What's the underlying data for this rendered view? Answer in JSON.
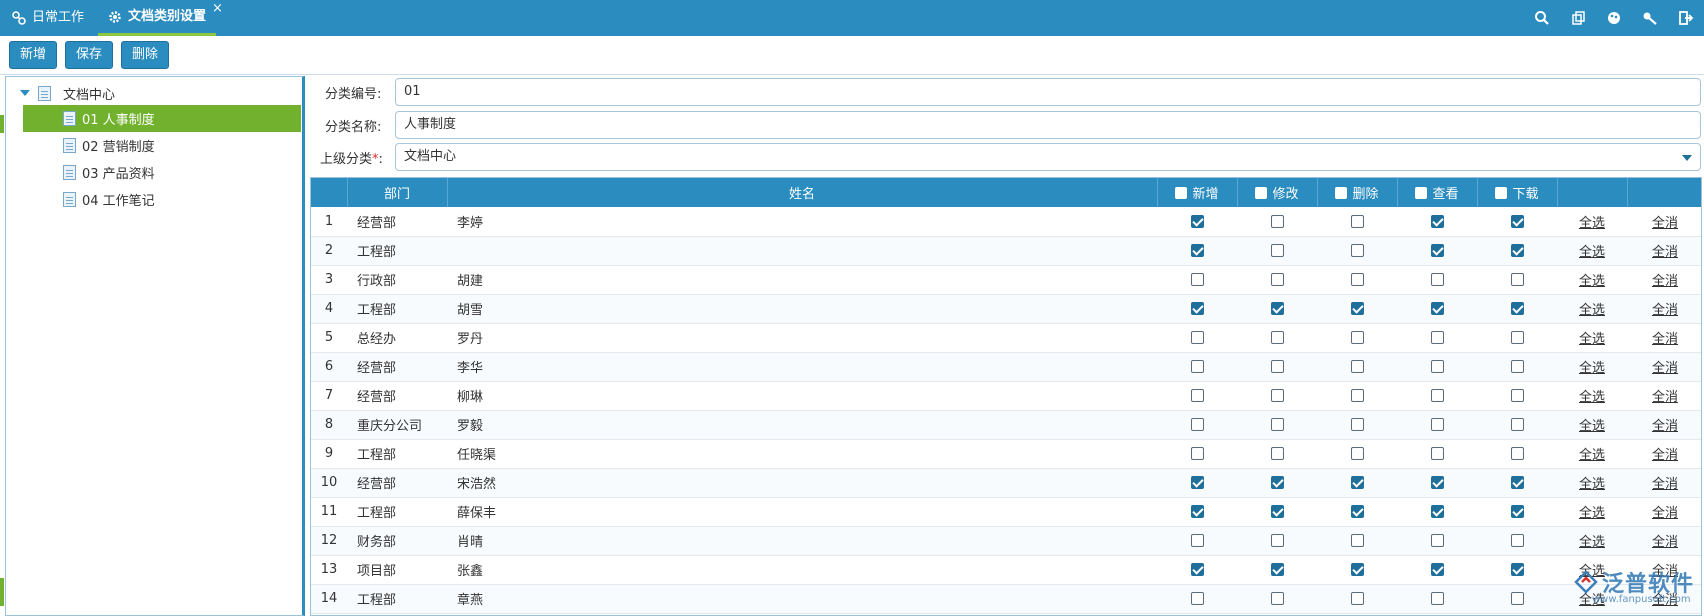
{
  "tabs": [
    {
      "label": "日常工作",
      "icon": "link-icon"
    },
    {
      "label": "文档类别设置",
      "icon": "gear-icon",
      "active": true
    }
  ],
  "tab_close": "×",
  "top_icons": [
    "search-icon",
    "copy-icon",
    "skin-icon",
    "key-icon",
    "logout-icon"
  ],
  "toolbar": {
    "add": "新增",
    "save": "保存",
    "delete": "删除"
  },
  "tree": {
    "root": "文档中心",
    "items": [
      "01 人事制度",
      "02 营销制度",
      "03 产品资料",
      "04 工作笔记"
    ],
    "selected_index": 0
  },
  "form": {
    "code_label": "分类编号:",
    "code_value": "01",
    "name_label": "分类名称:",
    "name_value": "人事制度",
    "parent_label": "上级分类",
    "parent_required": "*",
    "parent_colon": ":",
    "parent_value": "文档中心"
  },
  "grid": {
    "headers": {
      "dept": "部门",
      "name": "姓名",
      "add": "新增",
      "edit": "修改",
      "del": "删除",
      "view": "查看",
      "download": "下载"
    },
    "select_all": "全选",
    "deselect_all": "全消",
    "rows": [
      {
        "no": "1",
        "dept": "经营部",
        "name": "李婷",
        "perms": [
          true,
          false,
          false,
          true,
          true
        ]
      },
      {
        "no": "2",
        "dept": "工程部",
        "name": "",
        "perms": [
          true,
          false,
          false,
          true,
          true
        ]
      },
      {
        "no": "3",
        "dept": "行政部",
        "name": "胡建",
        "perms": [
          false,
          false,
          false,
          false,
          false
        ]
      },
      {
        "no": "4",
        "dept": "工程部",
        "name": "胡雪",
        "perms": [
          true,
          true,
          true,
          true,
          true
        ]
      },
      {
        "no": "5",
        "dept": "总经办",
        "name": "罗丹",
        "perms": [
          false,
          false,
          false,
          false,
          false
        ]
      },
      {
        "no": "6",
        "dept": "经营部",
        "name": "李华",
        "perms": [
          false,
          false,
          false,
          false,
          false
        ]
      },
      {
        "no": "7",
        "dept": "经营部",
        "name": "柳琳",
        "perms": [
          false,
          false,
          false,
          false,
          false
        ]
      },
      {
        "no": "8",
        "dept": "重庆分公司",
        "name": "罗毅",
        "perms": [
          false,
          false,
          false,
          false,
          false
        ]
      },
      {
        "no": "9",
        "dept": "工程部",
        "name": "任晓渠",
        "perms": [
          false,
          false,
          false,
          false,
          false
        ]
      },
      {
        "no": "10",
        "dept": "经营部",
        "name": "宋浩然",
        "perms": [
          true,
          true,
          true,
          true,
          true
        ]
      },
      {
        "no": "11",
        "dept": "工程部",
        "name": "薛保丰",
        "perms": [
          true,
          true,
          true,
          true,
          true
        ]
      },
      {
        "no": "12",
        "dept": "财务部",
        "name": "肖晴",
        "perms": [
          false,
          false,
          false,
          false,
          false
        ]
      },
      {
        "no": "13",
        "dept": "项目部",
        "name": "张鑫",
        "perms": [
          true,
          true,
          true,
          true,
          true
        ]
      },
      {
        "no": "14",
        "dept": "工程部",
        "name": "章燕",
        "perms": [
          false,
          false,
          false,
          false,
          false
        ]
      }
    ]
  },
  "watermark": {
    "brand": "泛普软件",
    "url": "www.fanpusoft.com"
  },
  "colors": {
    "primary": "#2b8cc0",
    "selected": "#71b12d",
    "checked": "#1f6f9b"
  }
}
